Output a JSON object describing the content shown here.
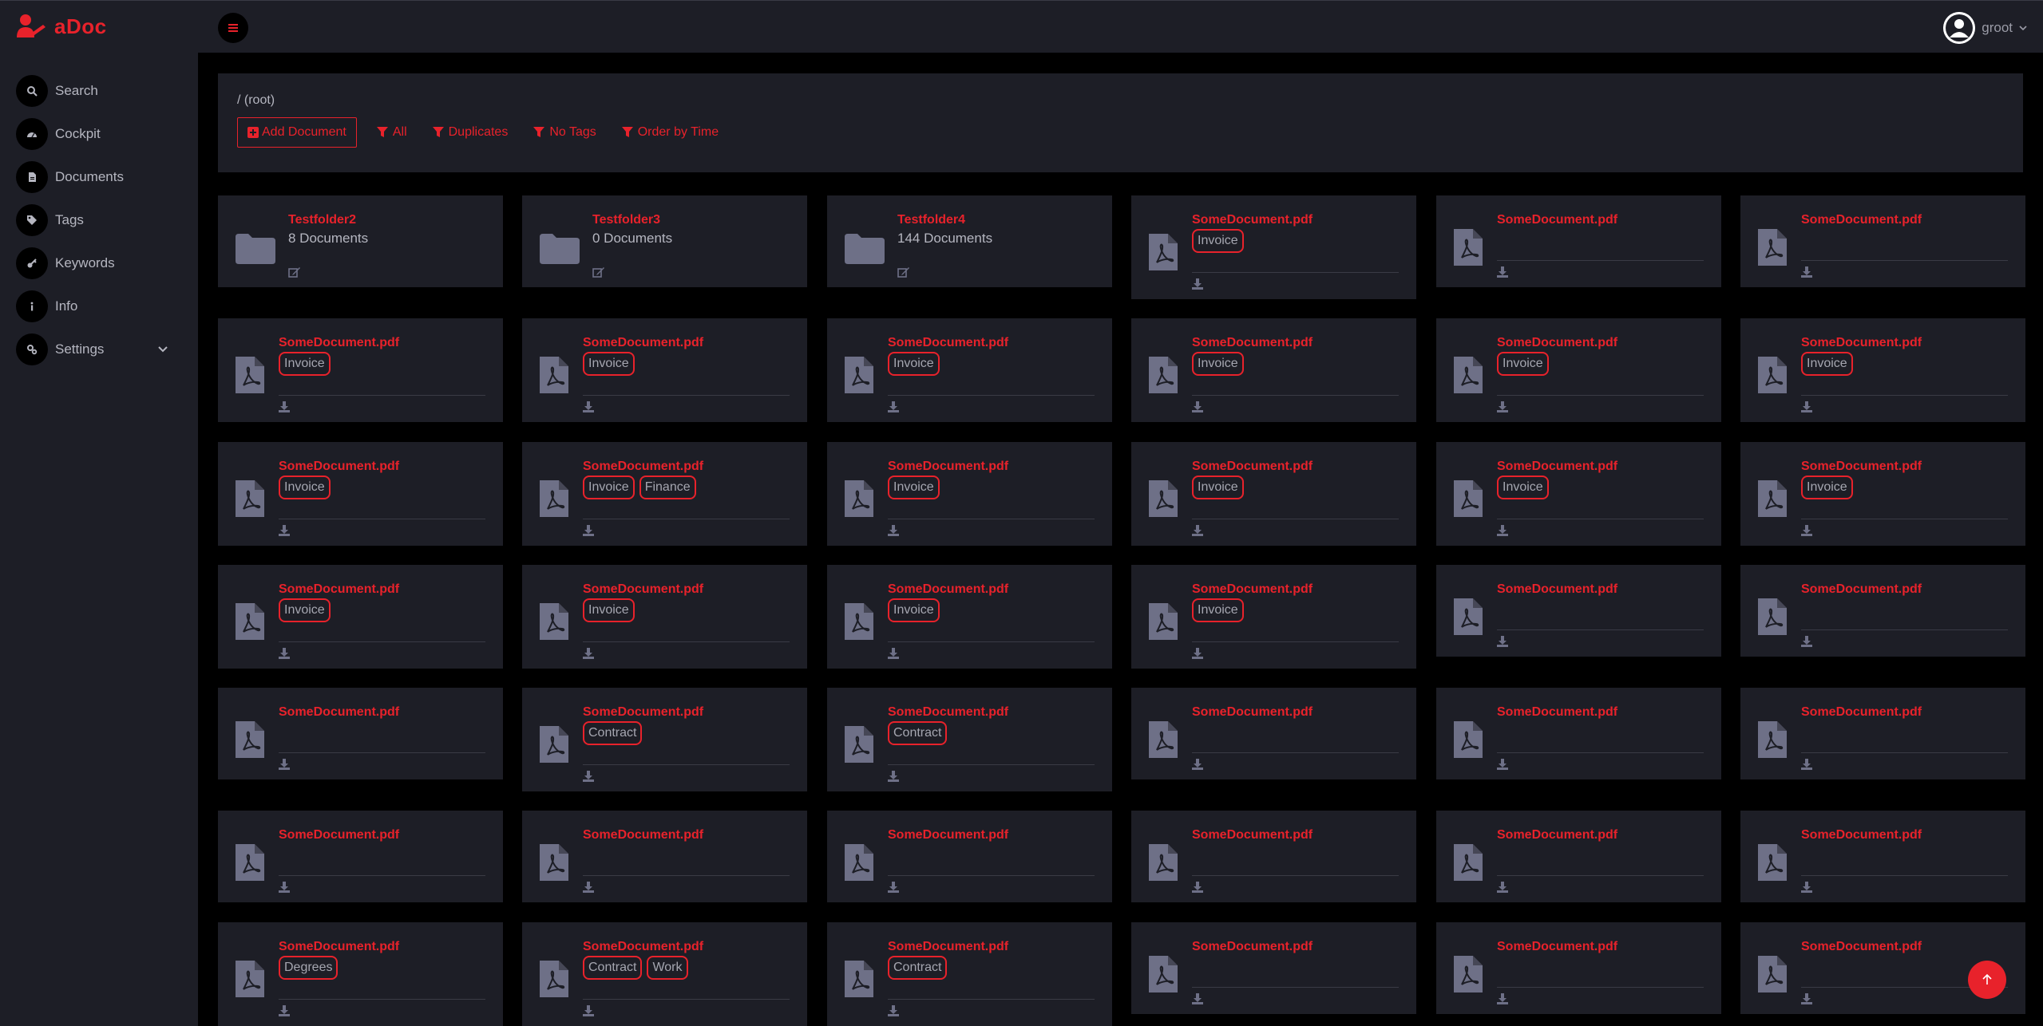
{
  "brand": {
    "name": "aDoc",
    "color": "#e8222b"
  },
  "sidebar": {
    "items": [
      {
        "label": "Search",
        "icon": "search-icon"
      },
      {
        "label": "Cockpit",
        "icon": "gauge-icon"
      },
      {
        "label": "Documents",
        "icon": "file-icon"
      },
      {
        "label": "Tags",
        "icon": "tags-icon"
      },
      {
        "label": "Keywords",
        "icon": "key-icon"
      },
      {
        "label": "Info",
        "icon": "info-icon"
      },
      {
        "label": "Settings",
        "icon": "gears-icon",
        "expandable": true
      }
    ]
  },
  "header": {
    "user": "groot"
  },
  "breadcrumb": "/ (root)",
  "toolbar": {
    "add_label": "Add Document",
    "filters": [
      "All",
      "Duplicates",
      "No Tags",
      "Order by Time"
    ]
  },
  "folders": [
    {
      "name": "Testfolder2",
      "count": "8 Documents"
    },
    {
      "name": "Testfolder3",
      "count": "0 Documents"
    },
    {
      "name": "Testfolder4",
      "count": "144 Documents"
    }
  ],
  "documents": [
    {
      "name": "SomeDocument.pdf",
      "tags": [
        "Invoice"
      ]
    },
    {
      "name": "SomeDocument.pdf",
      "tags": []
    },
    {
      "name": "SomeDocument.pdf",
      "tags": []
    },
    {
      "name": "SomeDocument.pdf",
      "tags": [
        "Invoice"
      ]
    },
    {
      "name": "SomeDocument.pdf",
      "tags": [
        "Invoice"
      ]
    },
    {
      "name": "SomeDocument.pdf",
      "tags": [
        "Invoice"
      ]
    },
    {
      "name": "SomeDocument.pdf",
      "tags": [
        "Invoice"
      ]
    },
    {
      "name": "SomeDocument.pdf",
      "tags": [
        "Invoice"
      ]
    },
    {
      "name": "SomeDocument.pdf",
      "tags": [
        "Invoice"
      ]
    },
    {
      "name": "SomeDocument.pdf",
      "tags": [
        "Invoice"
      ]
    },
    {
      "name": "SomeDocument.pdf",
      "tags": [
        "Invoice",
        "Finance"
      ]
    },
    {
      "name": "SomeDocument.pdf",
      "tags": [
        "Invoice"
      ]
    },
    {
      "name": "SomeDocument.pdf",
      "tags": [
        "Invoice"
      ]
    },
    {
      "name": "SomeDocument.pdf",
      "tags": [
        "Invoice"
      ]
    },
    {
      "name": "SomeDocument.pdf",
      "tags": [
        "Invoice"
      ]
    },
    {
      "name": "SomeDocument.pdf",
      "tags": [
        "Invoice"
      ]
    },
    {
      "name": "SomeDocument.pdf",
      "tags": [
        "Invoice"
      ]
    },
    {
      "name": "SomeDocument.pdf",
      "tags": [
        "Invoice"
      ]
    },
    {
      "name": "SomeDocument.pdf",
      "tags": [
        "Invoice"
      ]
    },
    {
      "name": "SomeDocument.pdf",
      "tags": []
    },
    {
      "name": "SomeDocument.pdf",
      "tags": []
    },
    {
      "name": "SomeDocument.pdf",
      "tags": []
    },
    {
      "name": "SomeDocument.pdf",
      "tags": [
        "Contract"
      ]
    },
    {
      "name": "SomeDocument.pdf",
      "tags": [
        "Contract"
      ]
    },
    {
      "name": "SomeDocument.pdf",
      "tags": []
    },
    {
      "name": "SomeDocument.pdf",
      "tags": []
    },
    {
      "name": "SomeDocument.pdf",
      "tags": []
    },
    {
      "name": "SomeDocument.pdf",
      "tags": []
    },
    {
      "name": "SomeDocument.pdf",
      "tags": []
    },
    {
      "name": "SomeDocument.pdf",
      "tags": []
    },
    {
      "name": "SomeDocument.pdf",
      "tags": []
    },
    {
      "name": "SomeDocument.pdf",
      "tags": []
    },
    {
      "name": "SomeDocument.pdf",
      "tags": []
    },
    {
      "name": "SomeDocument.pdf",
      "tags": [
        "Degrees"
      ]
    },
    {
      "name": "SomeDocument.pdf",
      "tags": [
        "Contract",
        "Work"
      ]
    },
    {
      "name": "SomeDocument.pdf",
      "tags": [
        "Contract"
      ]
    },
    {
      "name": "SomeDocument.pdf",
      "tags": []
    },
    {
      "name": "SomeDocument.pdf",
      "tags": []
    },
    {
      "name": "SomeDocument.pdf",
      "tags": []
    }
  ]
}
